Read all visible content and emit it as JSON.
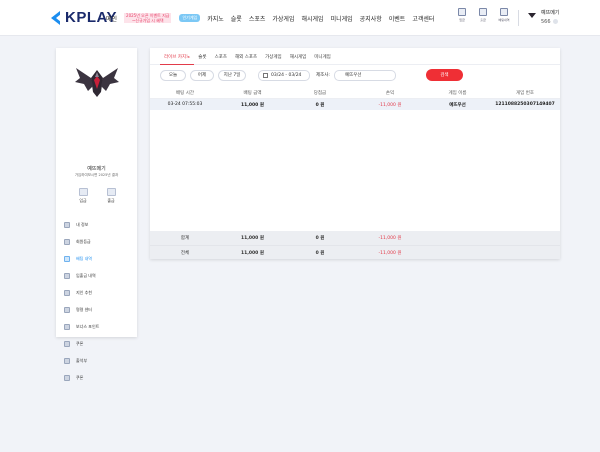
{
  "brand": {
    "name": "KPLAY",
    "accent": "#1c8ef0",
    "logo_text_color": "#1a2a6b"
  },
  "nav": {
    "items_left": [
      "메인"
    ],
    "promo_lines": [
      "2025년 오픈 이벤트 지급",
      "~신규가입 시 혜택"
    ],
    "tag": "인기게임",
    "items_right": [
      "카지노",
      "슬롯",
      "스포츠",
      "가상게임",
      "해시게임",
      "미니게임",
      "공지사항",
      "이벤트",
      "고객센터"
    ]
  },
  "top_icons": [
    {
      "icon": "chip-icon",
      "label": "입금"
    },
    {
      "icon": "card-icon",
      "label": "출금"
    },
    {
      "icon": "wallet-icon",
      "label": "베팅내역"
    }
  ],
  "user": {
    "name": "예뜨메기",
    "points": "566"
  },
  "sidebar": {
    "name": "예뜨메기",
    "subtitle": "가입하여보시면 2025년 결과",
    "deposit_label": "입금",
    "withdraw_label": "출금",
    "menu": [
      {
        "label": "내 정보",
        "icon": "user-icon",
        "active": false
      },
      {
        "label": "회원등급",
        "icon": "rank-icon",
        "active": false
      },
      {
        "label": "배팅 내역",
        "icon": "list-icon",
        "active": true
      },
      {
        "label": "입출금 내역",
        "icon": "exchange-icon",
        "active": false
      },
      {
        "label": "지인 추천",
        "icon": "referral-icon",
        "active": false
      },
      {
        "label": "명령 센터",
        "icon": "message-icon",
        "active": false
      },
      {
        "label": "보너스 포인트",
        "icon": "bonus-icon",
        "active": false
      },
      {
        "label": "쿠폰",
        "icon": "coupon-icon",
        "active": false
      },
      {
        "label": "출석부",
        "icon": "calendar-icon",
        "active": false
      },
      {
        "label": "쿠폰",
        "icon": "ticket-icon",
        "active": false
      }
    ]
  },
  "tabs": [
    "라이브 카지노",
    "슬롯",
    "스포츠",
    "해외 스포츠",
    "가상게임",
    "해시게임",
    "미니게임"
  ],
  "active_tab": 0,
  "filters": {
    "today": "오늘",
    "yesterday": "어제",
    "last7": "지난 7일",
    "date_range": "03/24 - 03/24",
    "game_label": "제조사:",
    "game_value": "예뜨우선",
    "search": "검색",
    "search_color": "#ef2f35"
  },
  "table": {
    "headers": [
      "배팅 시간",
      "배팅 금액",
      "당첨금",
      "손익",
      "게임 이름",
      "게임 번호"
    ],
    "rows": [
      [
        "03-24 07:55:03",
        "11,000 원",
        "0 원",
        "-11,000 원",
        "예뜨우선",
        "1211088250307149407"
      ]
    ],
    "summary": [
      [
        "합계",
        "11,000 원",
        "0 원",
        "-11,000 원"
      ],
      [
        "전체",
        "11,000 원",
        "0 원",
        "-11,000 원"
      ]
    ],
    "negative_color": "#e23b4a"
  }
}
